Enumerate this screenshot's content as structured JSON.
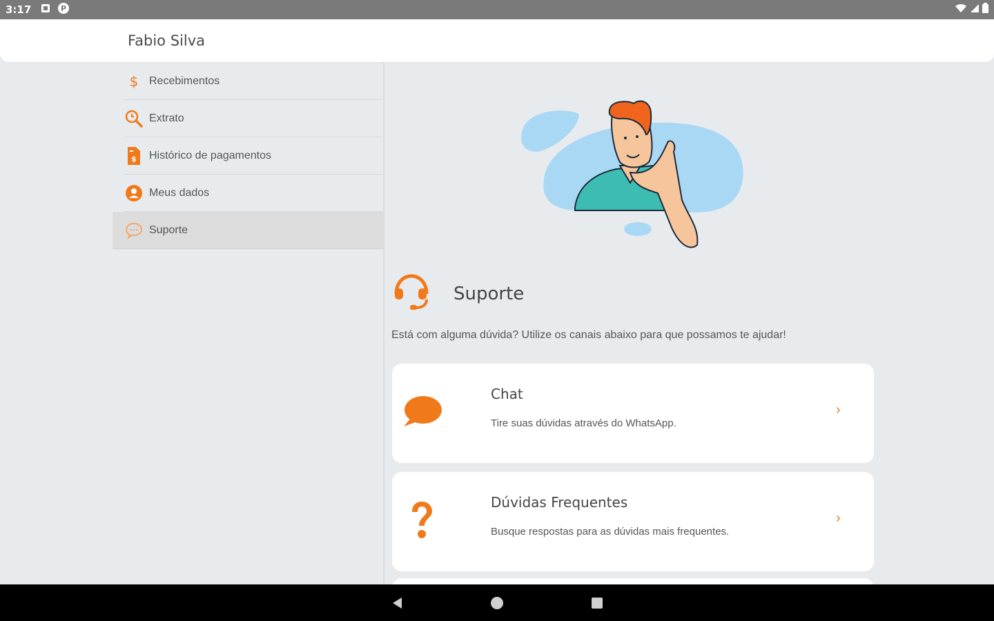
{
  "status_bar": {
    "time": "3:17"
  },
  "header": {
    "user_name": "Fabio Silva"
  },
  "sidebar": {
    "items": [
      {
        "label": "Recebimentos",
        "icon": "dollar-icon"
      },
      {
        "label": "Extrato",
        "icon": "search-clock-icon"
      },
      {
        "label": "Histórico de pagamentos",
        "icon": "payment-document-icon"
      },
      {
        "label": "Meus dados",
        "icon": "user-icon"
      },
      {
        "label": "Suporte",
        "icon": "chat-bubble-icon",
        "active": true
      }
    ]
  },
  "main": {
    "title": "Suporte",
    "description": "Está com alguma dúvida? Utilize os canais abaixo para que possamos te ajudar!",
    "cards": [
      {
        "title": "Chat",
        "subtitle": "Tire suas dúvidas através do WhatsApp.",
        "icon": "speech-bubble-icon"
      },
      {
        "title": "Dúvidas Frequentes",
        "subtitle": "Busque respostas para as dúvidas mais frequentes.",
        "icon": "question-mark-icon"
      }
    ]
  },
  "colors": {
    "accent": "#f07a1a",
    "background": "#e8ebee",
    "card": "#ffffff",
    "blob": "#a9d8f5"
  }
}
